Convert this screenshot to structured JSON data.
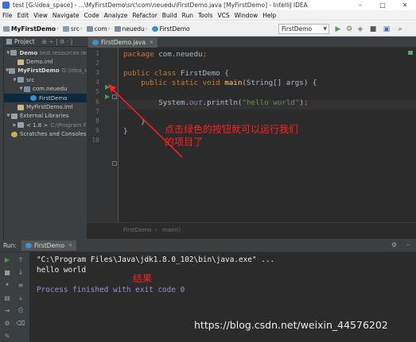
{
  "window": {
    "title": "test [G:\\idea_space] - ...\\MyFirstDemo\\src\\com\\neuedu\\FirstDemo.java [MyFirstDemo] - IntelliJ IDEA",
    "buttons": {
      "minimize": "–",
      "maximize": "□",
      "close": "✕"
    }
  },
  "menu": [
    "File",
    "Edit",
    "View",
    "Navigate",
    "Code",
    "Analyze",
    "Refactor",
    "Build",
    "Run",
    "Tools",
    "VCS",
    "Window",
    "Help"
  ],
  "navbar": {
    "breadcrumbs": [
      "MyFirstDemo",
      "src",
      "com",
      "neuedu",
      "FirstDemo"
    ],
    "run_config": "FirstDemo",
    "icons": {
      "run": "▶",
      "debug": "⚙",
      "build": "▣",
      "search": "⌕"
    }
  },
  "project_panel": {
    "header": "Project",
    "tree": [
      {
        "label": "Demo",
        "path": "test resources re",
        "indent": 0,
        "arrow": "▼",
        "icon": "folder",
        "bold": true
      },
      {
        "label": "Demo.iml",
        "path": "",
        "indent": 1,
        "arrow": "",
        "icon": "iml",
        "bold": false
      },
      {
        "label": "MyFirstDemo",
        "path": "G:\\idea_sp",
        "indent": 0,
        "arrow": "▼",
        "icon": "folder",
        "bold": true
      },
      {
        "label": "src",
        "path": "",
        "indent": 1,
        "arrow": "▼",
        "icon": "folder",
        "bold": false
      },
      {
        "label": "com.neuedu",
        "path": "",
        "indent": 2,
        "arrow": "▼",
        "icon": "package",
        "bold": false
      },
      {
        "label": "FirstDemo",
        "path": "",
        "indent": 3,
        "arrow": "",
        "icon": "class",
        "bold": false,
        "selected": true
      },
      {
        "label": "MyFirstDemo.iml",
        "path": "",
        "indent": 1,
        "arrow": "",
        "icon": "iml",
        "bold": false
      },
      {
        "label": "External Libraries",
        "path": "",
        "indent": 0,
        "arrow": "▼",
        "icon": "library",
        "bold": false
      },
      {
        "label": "< 1.8 >",
        "path": "C:\\Program F",
        "indent": 1,
        "arrow": "▶",
        "icon": "library",
        "bold": false
      },
      {
        "label": "Scratches and Consoles",
        "path": "",
        "indent": 0,
        "arrow": "",
        "icon": "scratch",
        "bold": false
      }
    ]
  },
  "editor": {
    "tab": "FirstDemo.java",
    "line_numbers": [
      "1",
      "2",
      "3",
      "4",
      "5",
      "6",
      "7",
      "8",
      "9",
      "10"
    ],
    "code": [
      {
        "n": 1,
        "tokens": [
          {
            "t": "package ",
            "c": "kw"
          },
          {
            "t": "com.neuedu",
            "c": ""
          },
          {
            "t": ";",
            "c": "kw"
          }
        ]
      },
      {
        "n": 2,
        "tokens": []
      },
      {
        "n": 3,
        "tokens": [
          {
            "t": "public class ",
            "c": "kw"
          },
          {
            "t": "FirstDemo {",
            "c": ""
          }
        ]
      },
      {
        "n": 4,
        "tokens": [
          {
            "t": "    public static void ",
            "c": "kw"
          },
          {
            "t": "main",
            "c": "mth"
          },
          {
            "t": "(String[] args) {",
            "c": ""
          }
        ]
      },
      {
        "n": 5,
        "tokens": []
      },
      {
        "n": 6,
        "tokens": [
          {
            "t": "        System",
            "c": ""
          },
          {
            "t": ".",
            "c": ""
          },
          {
            "t": "out",
            "c": "sys"
          },
          {
            "t": ".println(",
            "c": ""
          },
          {
            "t": "\"hello world\"",
            "c": "str"
          },
          {
            "t": ")",
            "c": ""
          },
          {
            "t": ";",
            "c": "kw"
          }
        ]
      },
      {
        "n": 7,
        "tokens": []
      },
      {
        "n": 8,
        "tokens": [
          {
            "t": "    }",
            "c": ""
          }
        ]
      },
      {
        "n": 9,
        "tokens": [
          {
            "t": "}",
            "c": ""
          }
        ]
      },
      {
        "n": 10,
        "tokens": []
      }
    ],
    "breadcrumb": [
      "FirstDemo",
      "main()"
    ]
  },
  "annotations": {
    "run_hint_line1": "点击绿色的按钮就可以运行我们",
    "run_hint_line2": "的项目了",
    "result": "结果"
  },
  "run_panel": {
    "label": "Run:",
    "tab": "FirstDemo",
    "console": [
      {
        "text": "\"C:\\Program Files\\Java\\jdk1.8.0_102\\bin\\java.exe\" ...",
        "kind": "cmd"
      },
      {
        "text": "hello world",
        "kind": "out"
      },
      {
        "text": "",
        "kind": "out"
      },
      {
        "text": "Process finished with exit code 0",
        "kind": "exit"
      }
    ]
  },
  "watermark": "https://blog.csdn.net/weixin_44576202",
  "colors": {
    "run_green": "#499c54",
    "annotation_red": "#ff2020",
    "editor_bg": "#2b2b2b",
    "panel_bg": "#3c3f41",
    "keyword": "#cc7832",
    "string": "#6a8759"
  }
}
